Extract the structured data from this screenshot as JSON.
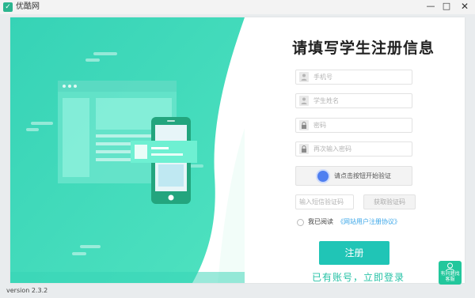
{
  "window": {
    "title": "优酷网",
    "min_glyph": "—",
    "max_glyph": "□",
    "close_glyph": "✕"
  },
  "form": {
    "title": "请填写学生注册信息",
    "phone_placeholder": "手机号",
    "name_placeholder": "学生姓名",
    "password_placeholder": "密码",
    "password_confirm_placeholder": "再次输入密码",
    "verify_label": "请点击按钮开始验证",
    "sms_placeholder": "输入短信验证码",
    "sms_button": "获取验证码",
    "agree_text": "我已阅读",
    "agree_link": "《网站用户注册协议》",
    "register_button": "注册",
    "login_link": "已有账号，立即登录"
  },
  "help": {
    "label": "有问题找客服"
  },
  "footer": {
    "version": "version 2.3.2"
  },
  "colors": {
    "accent": "#20c5b6",
    "illustration_bg": "#3fd9b8",
    "link": "#3aa6e8"
  },
  "icons": [
    "user-icon",
    "user-icon",
    "lock-icon",
    "lock-icon",
    "help-person-icon"
  ]
}
